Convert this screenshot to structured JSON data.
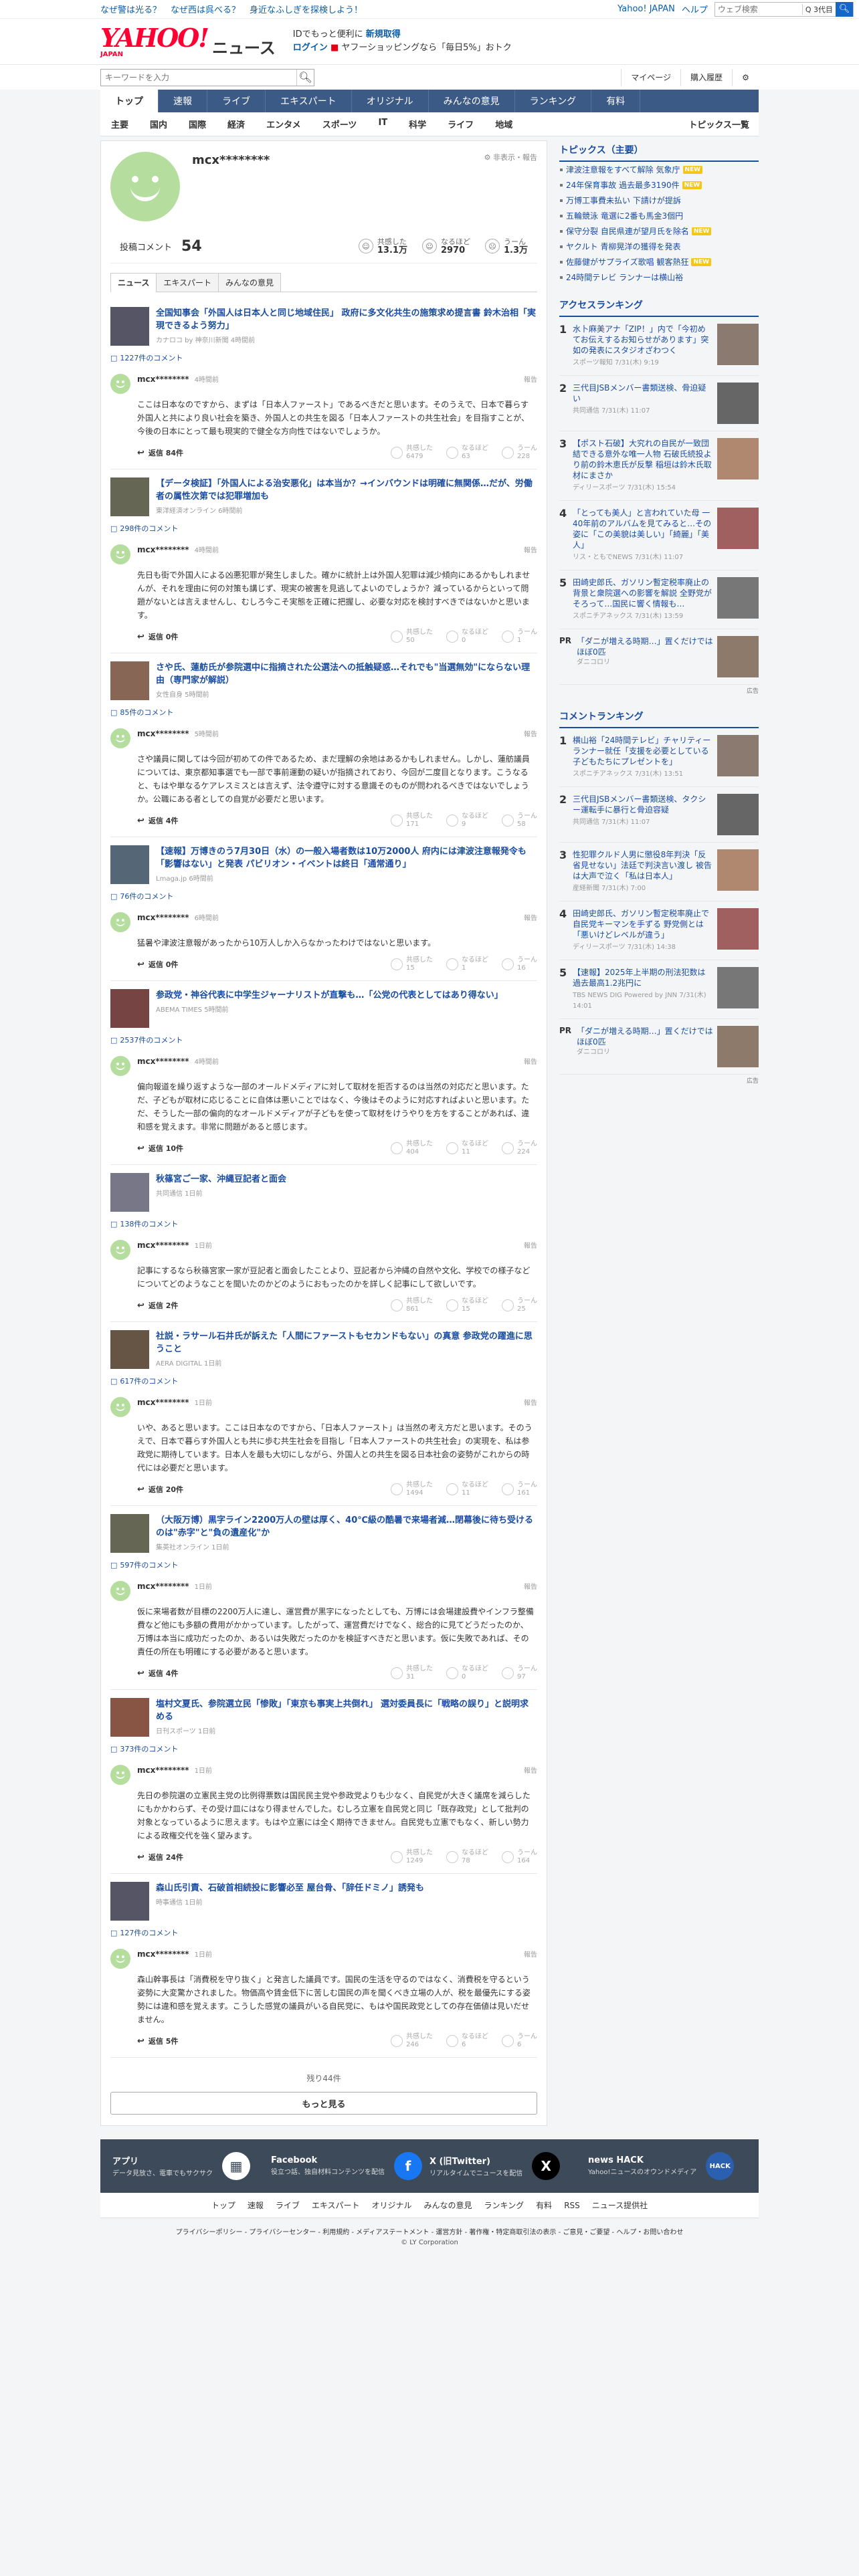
{
  "topstrip": {
    "links": [
      "なぜ警は光る？",
      "なぜ西は呉べる？",
      "身近なふしぎを探検しよう！"
    ],
    "portal": "Yahoo! JAPAN",
    "help": "ヘルプ",
    "search_placeholder": "ウェブ検索",
    "search_type": "Q 3代目"
  },
  "header": {
    "logo": "YAHOO!",
    "logo_sub": "JAPAN",
    "service": "ニュース",
    "promo_line1": "IDでもっと便利に",
    "promo_new": "新規取得",
    "promo_login": "ログイン",
    "promo_line2": "ヤフーショッピングなら「毎日5%」おトク"
  },
  "search": {
    "placeholder": "キーワードを入力",
    "mypage": "マイページ",
    "purchase": "購入履歴"
  },
  "gnav": [
    "トップ",
    "速報",
    "ライブ",
    "エキスパート",
    "オリジナル",
    "みんなの意見",
    "ランキング",
    "有料"
  ],
  "subnav": [
    "主要",
    "国内",
    "国際",
    "経済",
    "エンタメ",
    "スポーツ",
    "IT",
    "科学",
    "ライフ",
    "地域"
  ],
  "subnav_right": "トピックス一覧",
  "profile": {
    "name": "mcx********",
    "hide": "非表示・報告",
    "post_label": "投稿コメント",
    "post_count": "54",
    "reactions": [
      {
        "label": "共感した",
        "value": "13.1万"
      },
      {
        "label": "なるほど",
        "value": "2970"
      },
      {
        "label": "うーん",
        "value": "1.3万"
      }
    ]
  },
  "tabs": [
    "ニュース",
    "エキスパート",
    "みんなの意見"
  ],
  "items": [
    {
      "title": "全国知事会「外国人は日本人と同じ地域住民」 政府に多文化共生の施策求め提言書 鈴木治相「実現できるよう努力」",
      "source": "カナロコ by 神奈川新聞 4時間前",
      "count": "1227件のコメント",
      "user": "mcx********",
      "time": "4時間前",
      "body": "ここは日本なのですから、まずは「日本人ファースト」であるべきだと思います。そのうえで、日本で暮らす外国人と共により良い社会を築き、外国人との共生を図る「日本人ファーストの共生社会」を目指すことが、今後の日本にとって最も現実的で健全な方向性ではないでしょうか。",
      "replies": "返信 84件",
      "v": [
        "6479",
        "63",
        "228"
      ]
    },
    {
      "title": "【データ検証】「外国人による治安悪化」は本当か？→インバウンドは明確に無関係…だが、労働者の属性次第では犯罪増加も",
      "source": "東洋経済オンライン 6時間前",
      "count": "298件のコメント",
      "user": "mcx********",
      "time": "4時間前",
      "body": "先日も街で外国人による凶悪犯罪が発生しました。確かに統計上は外国人犯罪は減少傾向にあるかもしれませんが、それを理由に何の対策も講じず、現実の被害を見逃してよいのでしょうか？減っているからといって問題がないとは言えませんし、むしろ今こそ実態を正確に把握し、必要な対応を検討すべきではないかと思います。",
      "replies": "返信 0件",
      "v": [
        "50",
        "0",
        "1"
      ]
    },
    {
      "title": "さや氏、蓮舫氏が参院選中に指摘された公選法への抵触疑惑…それでも\"当選無効\"にならない理由（専門家が解説）",
      "source": "女性自身 5時間前",
      "count": "85件のコメント",
      "user": "mcx********",
      "time": "5時間前",
      "body": "さや議員に関しては今回が初めての件であるため、まだ理解の余地はあるかもしれません。しかし、蓮舫議員については、東京都知事選でも一部で事前運動の疑いが指摘されており、今回が二度目となります。こうなると、もはや単なるケアレスミスとは言えず、法令遵守に対する意識そのものが問われるべきではないでしょうか。公職にある者としての自覚が必要だと思います。",
      "replies": "返信 4件",
      "v": [
        "171",
        "9",
        "58"
      ]
    },
    {
      "title": "【速報】万博きのう7月30日（水）の一般入場者数は10万2000人 府内には津波注意報発令も「影響はない」と発表 パビリオン・イベントは終日「通常通り」",
      "source": "Lmaga.jp 6時間前",
      "count": "76件のコメント",
      "user": "mcx********",
      "time": "6時間前",
      "body": "猛暑や津波注意報があったから10万人しか入らなかったわけではないと思います。",
      "replies": "返信 0件",
      "v": [
        "15",
        "1",
        "16"
      ]
    },
    {
      "title": "参政党・神谷代表に中学生ジャーナリストが直撃も…「公党の代表としてはあり得ない」",
      "source": "ABEMA TIMES 5時間前",
      "count": "2537件のコメント",
      "user": "mcx********",
      "time": "4時間前",
      "body": "偏向報道を繰り返すような一部のオールドメディアに対して取材を拒否するのは当然の対応だと思います。ただ、子どもが取材に応じることに自体は悪いことではなく、今後はそのように対応すればよいと思います。ただ、そうした一部の偏向的なオールドメディアが子どもを使って取材をけうやりを方をすることがあれば、違和感を覚えます。非常に問題があると感じます。",
      "replies": "返信 10件",
      "v": [
        "404",
        "11",
        "224"
      ]
    },
    {
      "title": "秋篠宮ご一家、沖縄豆記者と面会",
      "source": "共同通信 1日前",
      "count": "138件のコメント",
      "user": "mcx********",
      "time": "1日前",
      "body": "記事にするなら秋篠宮家一家が豆記者と面会したことより、豆記者から沖縄の自然や文化、学校での様子などについてどのようなことを聞いたのかどのようにおもったのかを詳しく記事にして欲しいです。",
      "replies": "返信 2件",
      "v": [
        "861",
        "15",
        "25"
      ]
    },
    {
      "title": "社説・ラサール石井氏が訴えた「人間にファーストもセカンドもない」の真意 参政党の躍進に思うこと",
      "source": "AERA DIGITAL 1日前",
      "count": "617件のコメント",
      "user": "mcx********",
      "time": "1日前",
      "body": "いや、あると思います。ここは日本なのですから、「日本人ファースト」は当然の考え方だと思います。そのうえで、日本で暮らす外国人とも共に歩む共生社会を目指し「日本人ファーストの共生社会」の実現を、私は参政党に期待しています。日本人を最も大切にしながら、外国人との共生を図る日本社会の姿勢がこれからの時代には必要だと思います。",
      "replies": "返信 20件",
      "v": [
        "1494",
        "11",
        "161"
      ]
    },
    {
      "title": "（大阪万博）黒字ライン2200万人の壁は厚く、40℃級の酷暑で来場者減…閉幕後に待ち受けるのは\"赤字\"と\"負の遺産化\"か",
      "source": "集英社オンライン 1日前",
      "count": "597件のコメント",
      "user": "mcx********",
      "time": "1日前",
      "body": "仮に来場者数が目標の2200万人に達し、運営費が黒字になったとしても、万博には会場建設費やインフラ整備費など他にも多額の費用がかかっています。したがって、運営費だけでなく、総合的に見てどうだったのか、万博は本当に成功だったのか、あるいは失敗だったのかを検証すべきだと思います。仮に失敗であれば、その責任の所在も明確にする必要があると思います。",
      "replies": "返信 4件",
      "v": [
        "31",
        "0",
        "97"
      ]
    },
    {
      "title": "塩村文夏氏、参院選立民「惨敗」「東京も事実上共倒れ」 選対委員長に「戦略の誤り」と説明求める",
      "source": "日刊スポーツ 1日前",
      "count": "373件のコメント",
      "user": "mcx********",
      "time": "1日前",
      "body": "先日の参院選の立憲民主党の比例得票数は国民民主党や参政党よりも少なく、自民党が大きく議席を減らしたにもかかわらず、その受け皿にはなり得ませんでした。むしろ立憲を自民党と同じ「既存政党」として批判の対象となっているように思えます。もはや立憲には全く期待できません。自民党も立憲でもなく、新しい勢力による政権交代を強く望みます。",
      "replies": "返信 24件",
      "v": [
        "1249",
        "78",
        "164"
      ]
    },
    {
      "title": "森山氏引責、石破首相続投に影響必至 屋台骨、「辞任ドミノ」誘発も",
      "source": "時事通信 1日前",
      "count": "127件のコメント",
      "user": "mcx********",
      "time": "1日前",
      "body": "森山幹事長は「消費税を守り抜く」と発言した議員です。国民の生活を守るのではなく、消費税を守るという姿勢に大変驚かされました。物価高や賃金低下に苦しむ国民の声を聞くべき立場の人が、税を最優先にする姿勢には違和感を覚えます。こうした感覚の議員がいる自民党に、もはや国民政党としての存在価値は見いだせません。",
      "replies": "返信 5件",
      "v": [
        "246",
        "6",
        "6"
      ]
    }
  ],
  "vote_labels": [
    "共感した",
    "なるほど",
    "うーん"
  ],
  "remain": "残り44件",
  "more": "もっと見る",
  "topics": {
    "title": "トピックス（主要）",
    "items": [
      {
        "t": "津波注意報をすべて解除 気象庁",
        "b": "NEW"
      },
      {
        "t": "24年保育事故 過去最多3190件",
        "b": "NEW"
      },
      {
        "t": "万博工事費未払い 下請けが提訴",
        "b": ""
      },
      {
        "t": "五輪競泳 竜選に2番も馬金3個円",
        "b": ""
      },
      {
        "t": "保守分裂 自民県連が望月氏を除名",
        "b": "NEW"
      },
      {
        "t": "ヤクルト 青柳晃洋の獲得を発表",
        "b": ""
      },
      {
        "t": "佐藤健がサプライズ歌唱 観客熱狂",
        "b": "NEW"
      },
      {
        "t": "24時間テレビ ランナーは横山裕",
        "b": ""
      }
    ]
  },
  "access": {
    "title": "アクセスランキング",
    "items": [
      {
        "t": "水卜麻美アナ「ZIP！」内で「今初めてお伝えするお知らせがあります」突如の発表にスタジオざわつく",
        "s": "スポーツ報知 7/31(木) 9:19"
      },
      {
        "t": "三代目JSBメンバー書類送検、骨迫疑い",
        "s": "共同通信 7/31(木) 11:07"
      },
      {
        "t": "【ポスト石破】大究れの自民が一致団結できる意外な唯一人物 石破氏続投より前の鈴木恵氏が反撃 稲垣は鈴木氏取材にまさか",
        "s": "ディリースポーツ 7/31(木) 15:54"
      },
      {
        "t": "「とっても美人」と言われていた母 一40年前のアルバムを見てみると…その姿に「この美貌は美しい」「綺麗」「美人」",
        "s": "リス・ともでNEWS 7/31(木) 11:07"
      },
      {
        "t": "田崎史郎氏、ガソリン暫定税率廃止の背景と衆院選への影響を解説 全野党がそろって…国民に響く情報も…",
        "s": "スポニチアネックス 7/31(木) 13:59"
      }
    ]
  },
  "pr": {
    "label": "PR",
    "t": "「ダニが増える時期…」置くだけではほぼ0匹",
    "s": "ダニコロリ",
    "ad": "広告"
  },
  "comment_rank": {
    "title": "コメントランキング",
    "items": [
      {
        "t": "横山裕「24時間テレビ」チャリティーランナー就任「支援を必要としている子どもたちにプレゼントを」",
        "s": "スポニチアネックス 7/31(木) 13:51"
      },
      {
        "t": "三代目JSBメンバー書類送検、タクシー運転手に暴行と骨迫容疑",
        "s": "共同通信 7/31(木) 11:07"
      },
      {
        "t": "性犯罪クルド人男に懲役8年判決「反省見せない」法廷で判決言い渡し 被告は大声で泣く「私は日本人」",
        "s": "産経新聞 7/31(木) 7:00"
      },
      {
        "t": "田崎史郎氏、ガソリン暫定税率廃止で自民党キーマンを手ずる 野党側とは「悪いけどレベルが違う」",
        "s": "ディリースポーツ 7/31(木) 14:38"
      },
      {
        "t": "【速報】2025年上半期の刑法犯数は過去最高1.2兆円に",
        "s": "TBS NEWS DIG Powered by JNN 7/31(木) 14:01"
      }
    ]
  },
  "footer": {
    "cols": [
      {
        "h": "アプリ",
        "d": "データ見放さ、電車でもサクサク",
        "icon": "app-icon"
      },
      {
        "h": "Facebook",
        "d": "役立つ話、独自材料コンテンツを配信",
        "icon": "facebook-icon"
      },
      {
        "h": "X (旧Twitter)",
        "d": "リアルタイムでニュースを配信",
        "icon": "x-icon"
      },
      {
        "h": "news HACK",
        "d": "Yahoo!ニュースのオウンドメディア",
        "icon": "hack-icon"
      }
    ],
    "nav": [
      "トップ",
      "速報",
      "ライブ",
      "エキスパート",
      "オリジナル",
      "みんなの意見",
      "ランキング",
      "有料",
      "RSS",
      "ニュース提供社"
    ],
    "links": "プライバシーポリシー - プライバシーセンター - 利用規約 - メディアステートメント - 運営方針 - 著作権・特定商取引法の表示 - ご意見・ご要望 - ヘルプ・お問い合わせ",
    "copy": "© LY Corporation"
  }
}
